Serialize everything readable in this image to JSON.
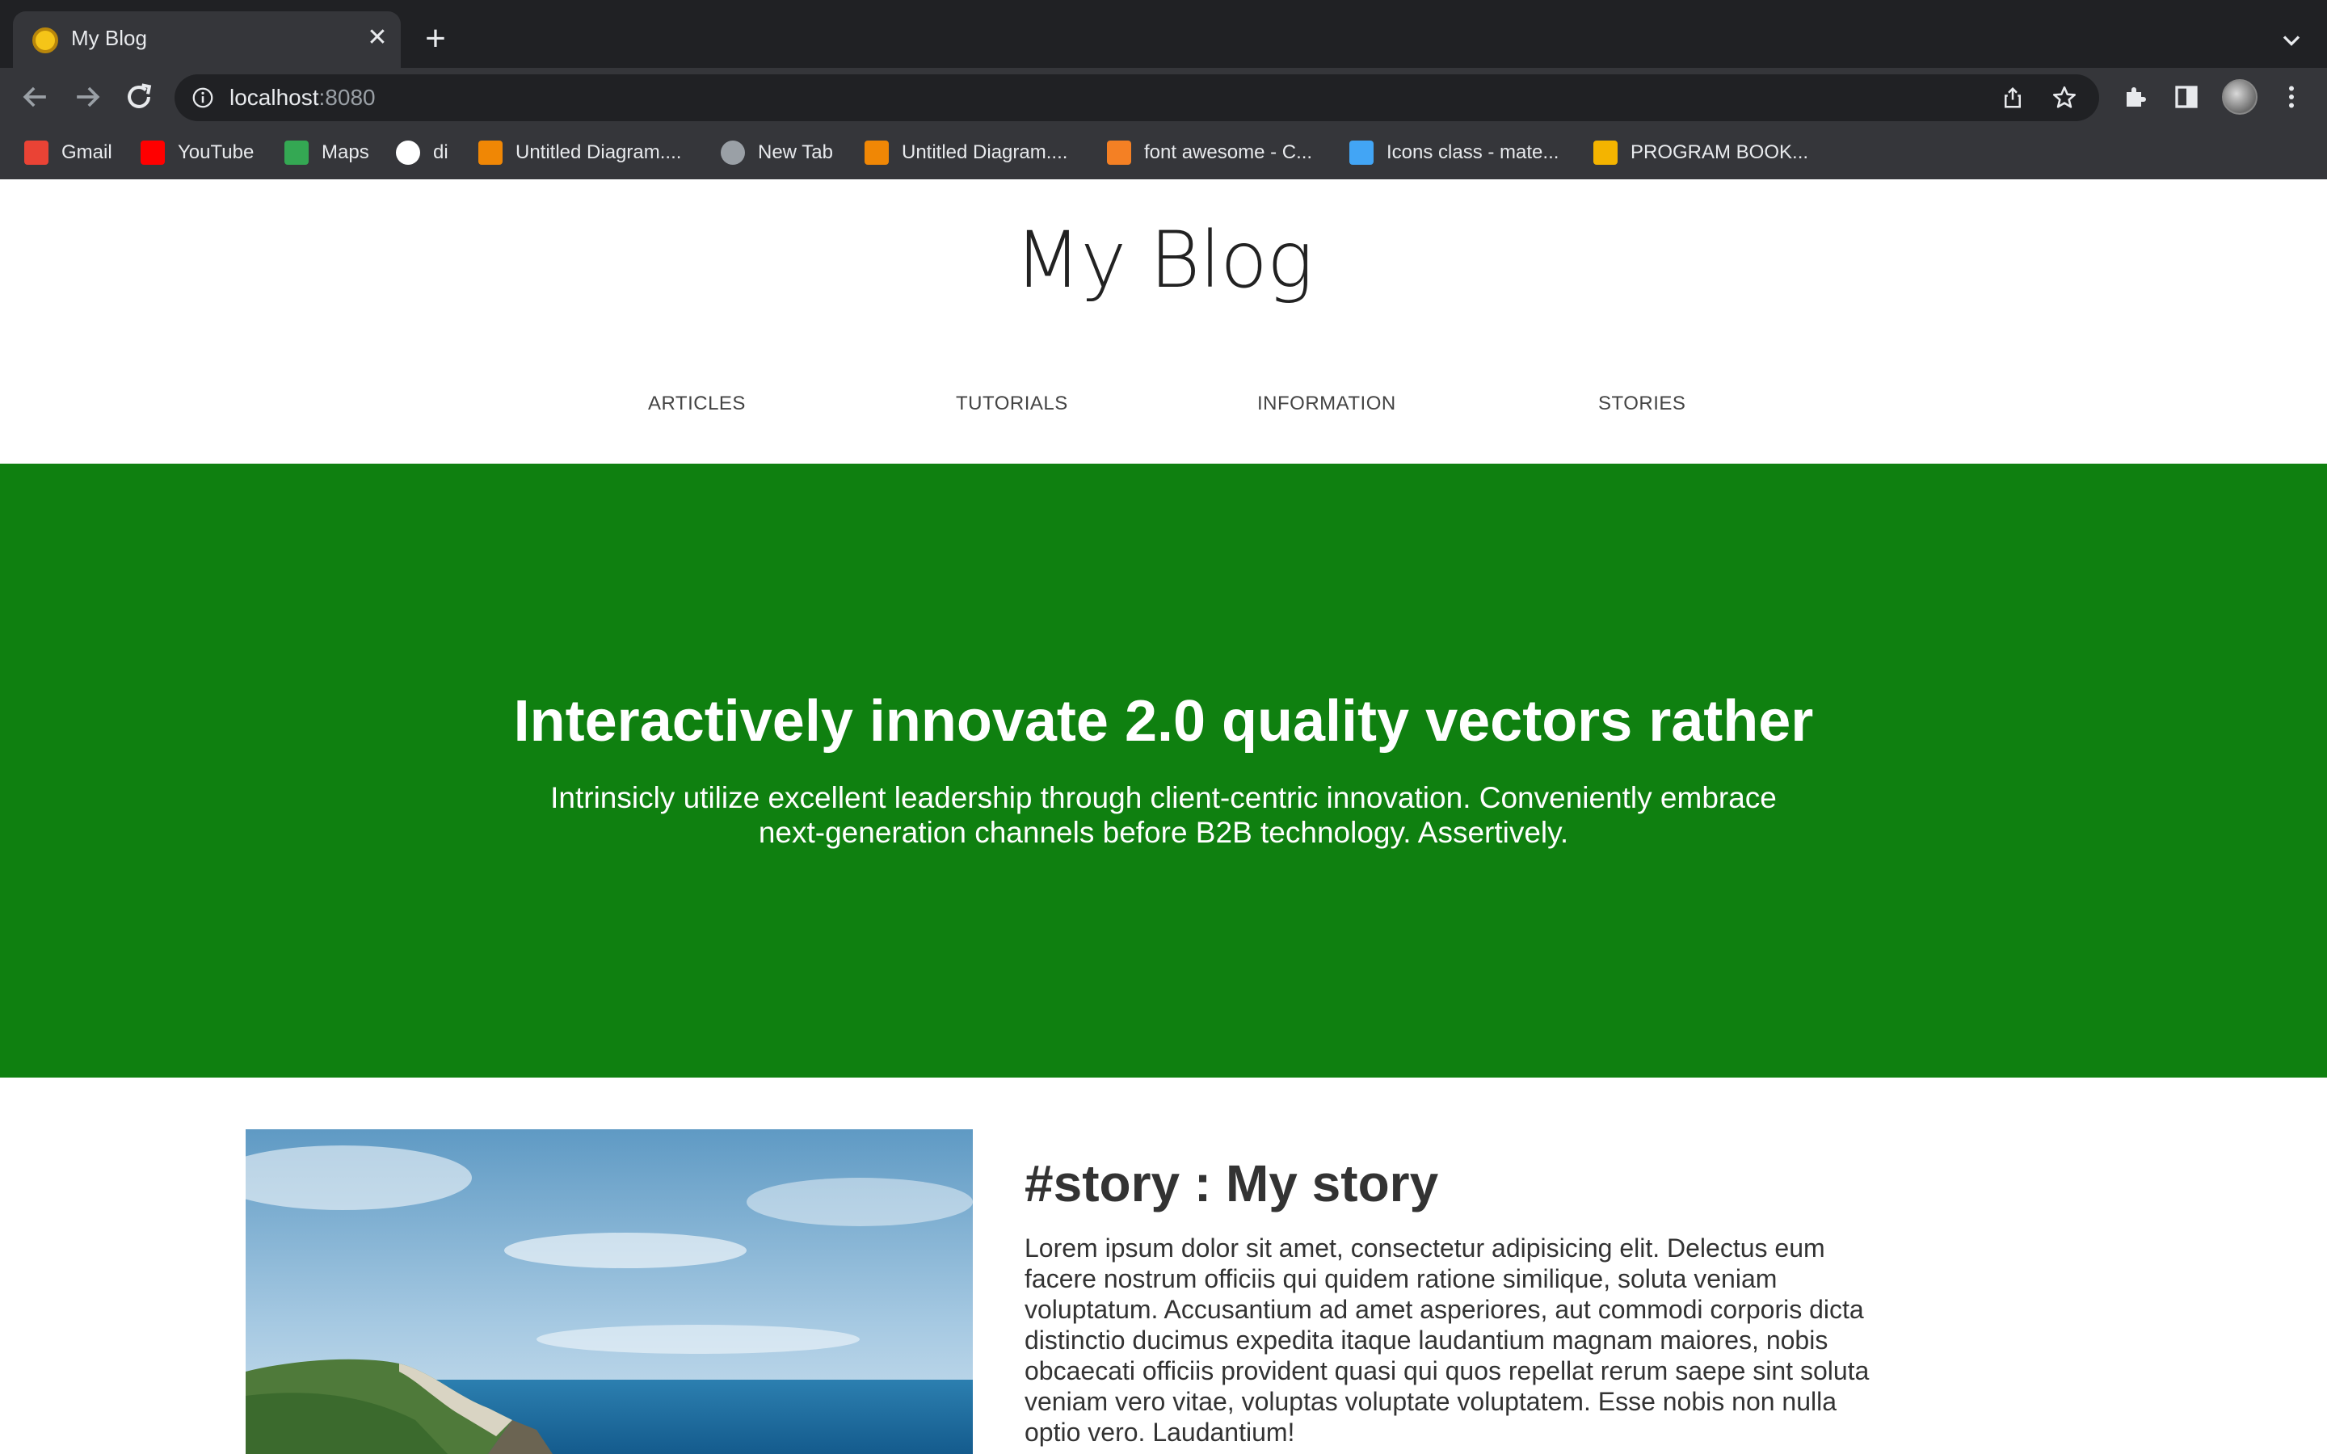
{
  "browser": {
    "tab": {
      "title": "My Blog",
      "close_glyph": "✕"
    },
    "new_tab_glyph": "+",
    "omnibox": {
      "host": "localhost",
      "port": ":8080"
    },
    "bookmarks": [
      {
        "label": "Gmail",
        "icon": "gmail-icon",
        "color": "#ea4335"
      },
      {
        "label": "YouTube",
        "icon": "youtube-icon",
        "color": "#ff0000"
      },
      {
        "label": "Maps",
        "icon": "maps-icon",
        "color": "#34a853"
      },
      {
        "label": "di",
        "icon": "github-icon",
        "color": "#ffffff"
      },
      {
        "label": "Untitled Diagram....",
        "icon": "drawio-icon",
        "color": "#f08705"
      },
      {
        "label": "New Tab",
        "icon": "globe-icon",
        "color": "#9aa0a6"
      },
      {
        "label": "Untitled Diagram....",
        "icon": "drawio-icon",
        "color": "#f08705"
      },
      {
        "label": "font awesome - C...",
        "icon": "stackoverflow-icon",
        "color": "#f48024"
      },
      {
        "label": "Icons class - mate...",
        "icon": "flutter-icon",
        "color": "#42a5f5"
      },
      {
        "label": "PROGRAM BOOK...",
        "icon": "slides-icon",
        "color": "#f4b400"
      }
    ]
  },
  "page": {
    "site_title": "My Blog",
    "nav": [
      "ARTICLES",
      "TUTORIALS",
      "INFORMATION",
      "STORIES"
    ],
    "hero": {
      "title": "Interactively innovate 2.0 quality vectors rather",
      "text": "Intrinsicly utilize excellent leadership through client-centric innovation. Conveniently embrace next-generation channels before B2B technology. Assertively.",
      "background_color": "#0f8010"
    },
    "story": {
      "title": "#story : My story",
      "text": "Lorem ipsum dolor sit amet, consectetur adipisicing elit. Delectus eum facere nostrum officiis qui quidem ratione similique, soluta veniam voluptatum. Accusantium ad amet asperiores, aut commodi corporis dicta distinctio ducimus expedita itaque laudantium magnam maiores, nobis obcaecati officiis provident quasi qui quos repellat rerum saepe sint soluta veniam vero vitae, voluptas voluptate voluptatem. Esse nobis non nulla optio vero. Laudantium!"
    }
  }
}
